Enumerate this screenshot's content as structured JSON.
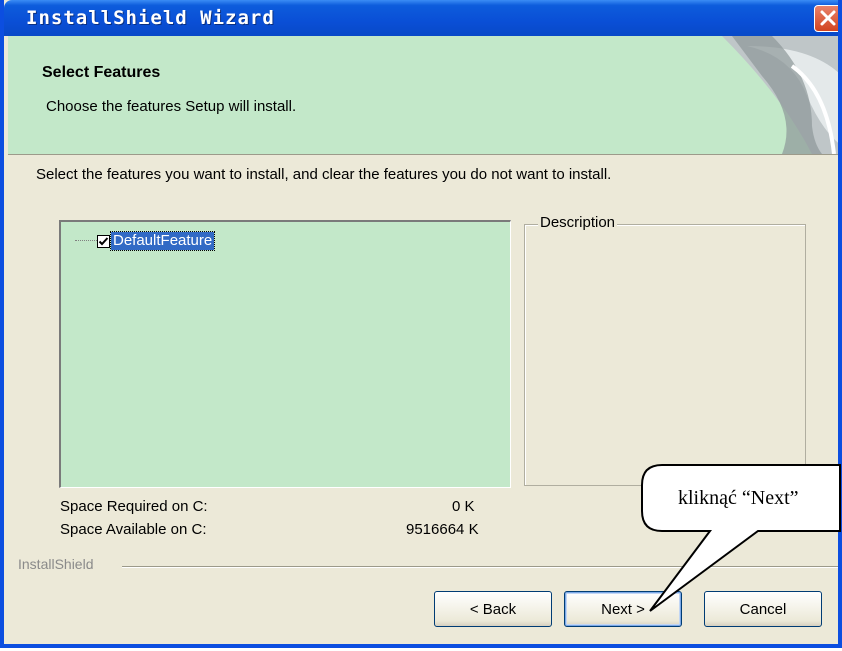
{
  "window": {
    "title": "InstallShield Wizard",
    "close_icon": "close-x-icon",
    "accent_color": "#0a4fd6"
  },
  "header": {
    "title": "Select Features",
    "subtitle": "Choose the features Setup will install."
  },
  "body": {
    "instruction": "Select the features you want to install, and clear the features you do not want to install.",
    "features": [
      {
        "label": "DefaultFeature",
        "checked": true,
        "selected": true
      }
    ],
    "description_label": "Description",
    "space": [
      {
        "label": "Space Required on  C:",
        "value": "0 K"
      },
      {
        "label": "Space Available on  C:",
        "value": "9516664 K"
      }
    ]
  },
  "footer": {
    "brand": "InstallShield",
    "back_label": "< Back",
    "next_label": "Next >",
    "cancel_label": "Cancel"
  },
  "annotation": {
    "callout_text": "kliknąć “Next”"
  }
}
